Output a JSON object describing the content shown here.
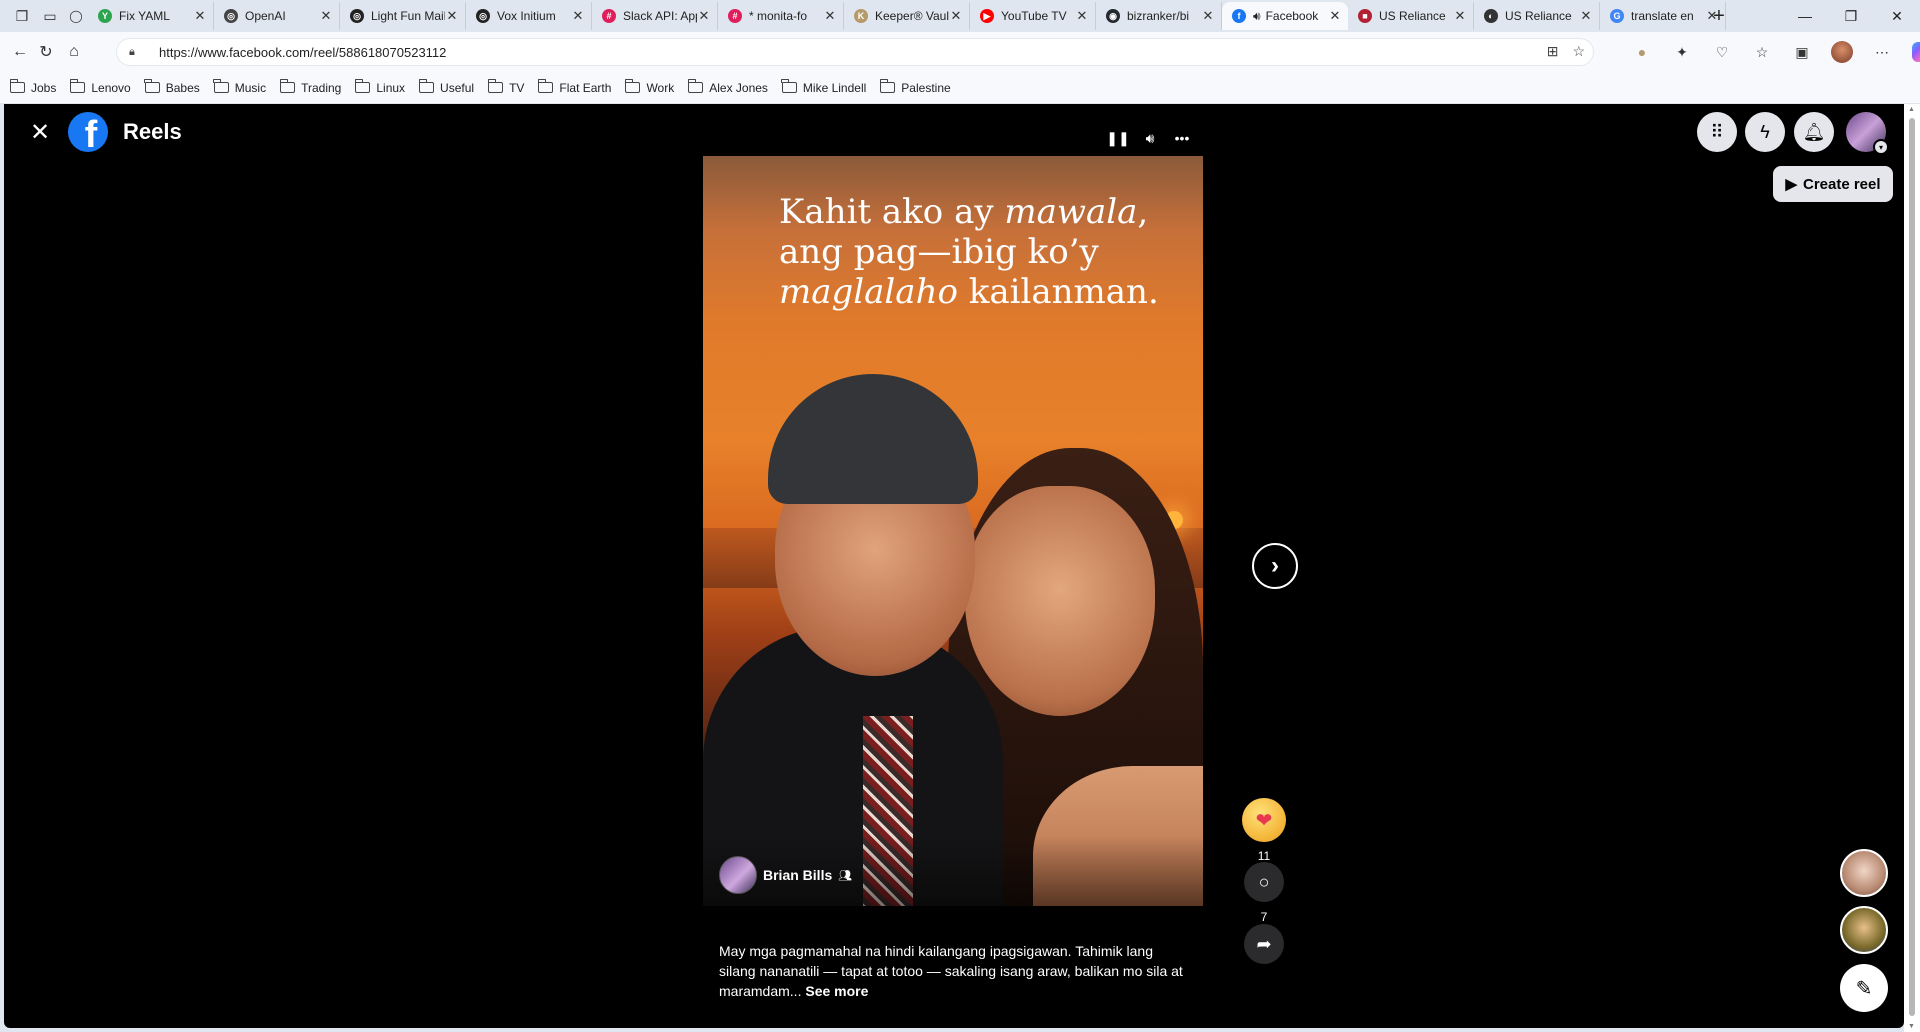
{
  "browser": {
    "tabs": [
      {
        "label": "Fix YAML",
        "fav_color": "#2da44e",
        "fav_glyph": "Y"
      },
      {
        "label": "OpenAI",
        "fav_color": "#444444",
        "fav_glyph": "◎"
      },
      {
        "label": "Light Fun Mail",
        "fav_color": "#222222",
        "fav_glyph": "◎"
      },
      {
        "label": "Vox Initium",
        "fav_color": "#222222",
        "fav_glyph": "◎"
      },
      {
        "label": "Slack API: App",
        "fav_color": "#e01e5a",
        "fav_glyph": "#"
      },
      {
        "label": "* monita-fo",
        "fav_color": "#e01e5a",
        "fav_glyph": "#"
      },
      {
        "label": "Keeper® Vault",
        "fav_color": "#b59a6a",
        "fav_glyph": "K"
      },
      {
        "label": "YouTube TV",
        "fav_color": "#ff0000",
        "fav_glyph": "▶"
      },
      {
        "label": "bizranker/bi",
        "fav_color": "#24292f",
        "fav_glyph": "◉"
      },
      {
        "label": "Facebook",
        "fav_color": "#1877f2",
        "fav_glyph": "f",
        "active": true
      },
      {
        "label": "US Reliance",
        "fav_color": "#b22234",
        "fav_glyph": "■"
      },
      {
        "label": "US Reliance",
        "fav_color": "#333333",
        "fav_glyph": "◐"
      },
      {
        "label": "translate en",
        "fav_color": "#4285f4",
        "fav_glyph": "G"
      }
    ],
    "url": "https://www.facebook.com/reel/588618070523112",
    "bookmarks": [
      "Jobs",
      "Lenovo",
      "Babes",
      "Music",
      "Trading",
      "Linux",
      "Useful",
      "TV",
      "Flat Earth",
      "Work",
      "Alex Jones",
      "Mike Lindell",
      "Palestine"
    ]
  },
  "page": {
    "title": "Reels",
    "create_reel_label": "Create reel",
    "quote": {
      "line1_plain": "Kahit ako ay ",
      "line1_italic": "mawala",
      "line1_end": ",",
      "line2": "ang pag—ibig ko’y",
      "line3_italic": "maglalaho",
      "line3_end": " kailanman."
    },
    "author": {
      "name": "Brian Bills"
    },
    "caption": "May mga pagmamahal na hindi kailangang ipagsigawan. Tahimik lang silang nananatili — tapat at totoo — sakaling isang araw, balikan mo sila at maramdam...",
    "see_more": "See more",
    "reactions_count": "11",
    "comments_count": "7"
  },
  "icons": {
    "close": "close-icon",
    "menu": "grid-menu-icon",
    "messenger": "messenger-icon",
    "notifications": "bell-icon"
  },
  "colors": {
    "facebook_blue": "#1877f2",
    "background": "#000000"
  }
}
